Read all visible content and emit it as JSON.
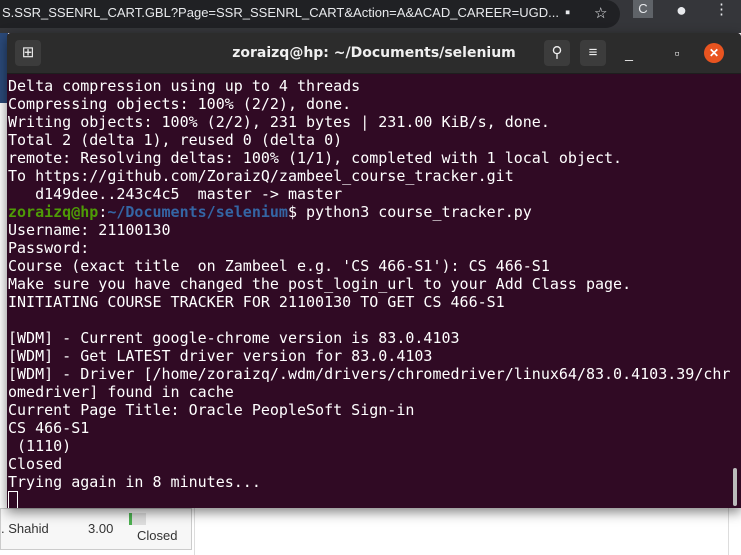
{
  "browser": {
    "url": "S.SSR_SSENRL_CART.GBL?Page=SSR_SSENRL_CART&Action=A&ACAD_CAREER=UGD...",
    "extension_label": "C"
  },
  "background_page": {
    "instructor": ". Shahid",
    "units": "3.00",
    "status": "Closed"
  },
  "terminal": {
    "title": "zoraizq@hp: ~/Documents/selenium",
    "lines": [
      "Delta compression using up to 4 threads",
      "Compressing objects: 100% (2/2), done.",
      "Writing objects: 100% (2/2), 231 bytes | 231.00 KiB/s, done.",
      "Total 2 (delta 1), reused 0 (delta 0)",
      "remote: Resolving deltas: 100% (1/1), completed with 1 local object.",
      "To https://github.com/ZoraizQ/zambeel_course_tracker.git",
      "   d149dee..243c4c5  master -> master"
    ],
    "prompt": {
      "user": "zoraizq@hp",
      "sep": ":",
      "path": "~/Documents/selenium",
      "dollar": "$",
      "command": " python3 course_tracker.py"
    },
    "output": [
      "Username: 21100130",
      "Password:",
      "Course (exact title  on Zambeel e.g. 'CS 466-S1'): CS 466-S1",
      "Make sure you have changed the post_login_url to your Add Class page.",
      "INITIATING COURSE TRACKER FOR 21100130 TO GET CS 466-S1",
      "",
      "[WDM] - Current google-chrome version is 83.0.4103",
      "[WDM] - Get LATEST driver version for 83.0.4103",
      "[WDM] - Driver [/home/zoraizq/.wdm/drivers/chromedriver/linux64/83.0.4103.39/chr",
      "omedriver] found in cache",
      "Current Page Title: Oracle PeopleSoft Sign-in",
      "CS 466-S1",
      " (1110)",
      "Closed",
      "Trying again in 8 minutes..."
    ]
  },
  "colors": {
    "terminal_bg": "#300a24",
    "prompt_user": "#4e9a06",
    "prompt_path": "#3465a4",
    "close": "#e95420"
  }
}
